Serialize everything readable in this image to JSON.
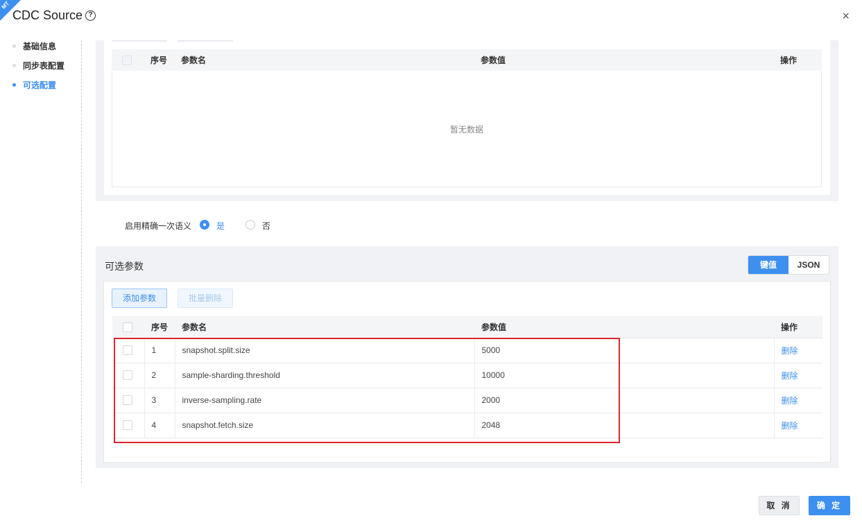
{
  "corner_tag": "MT",
  "title": "CDC Source",
  "help_icon": "?",
  "close_icon": "×",
  "sidenav": {
    "items": [
      {
        "label": "基础信息",
        "active": false
      },
      {
        "label": "同步表配置",
        "active": false
      },
      {
        "label": "可选配置",
        "active": true
      }
    ]
  },
  "top_table": {
    "headers": {
      "index": "序号",
      "name": "参数名",
      "value": "参数值",
      "op": "操作"
    },
    "empty_text": "暂无数据"
  },
  "exactly_once": {
    "label": "启用精确一次语义",
    "yes": "是",
    "no": "否",
    "selected": "是"
  },
  "optional": {
    "title": "可选参数",
    "toggle": {
      "kv": "键值",
      "json": "JSON",
      "selected": "键值"
    },
    "add_button": "添加参数",
    "batch_delete_button": "批量删除",
    "headers": {
      "index": "序号",
      "name": "参数名",
      "value": "参数值",
      "op": "操作"
    },
    "rows": [
      {
        "index": "1",
        "name": "snapshot.split.size",
        "value": "5000",
        "op": "删除"
      },
      {
        "index": "2",
        "name": "sample-sharding.threshold",
        "value": "10000",
        "op": "删除"
      },
      {
        "index": "3",
        "name": "inverse-sampling.rate",
        "value": "2000",
        "op": "删除"
      },
      {
        "index": "4",
        "name": "snapshot.fetch.size",
        "value": "2048",
        "op": "删除"
      }
    ]
  },
  "footer": {
    "cancel": "取 消",
    "ok": "确 定"
  },
  "colors": {
    "accent": "#3d8ff0",
    "highlight": "#e0242f"
  }
}
